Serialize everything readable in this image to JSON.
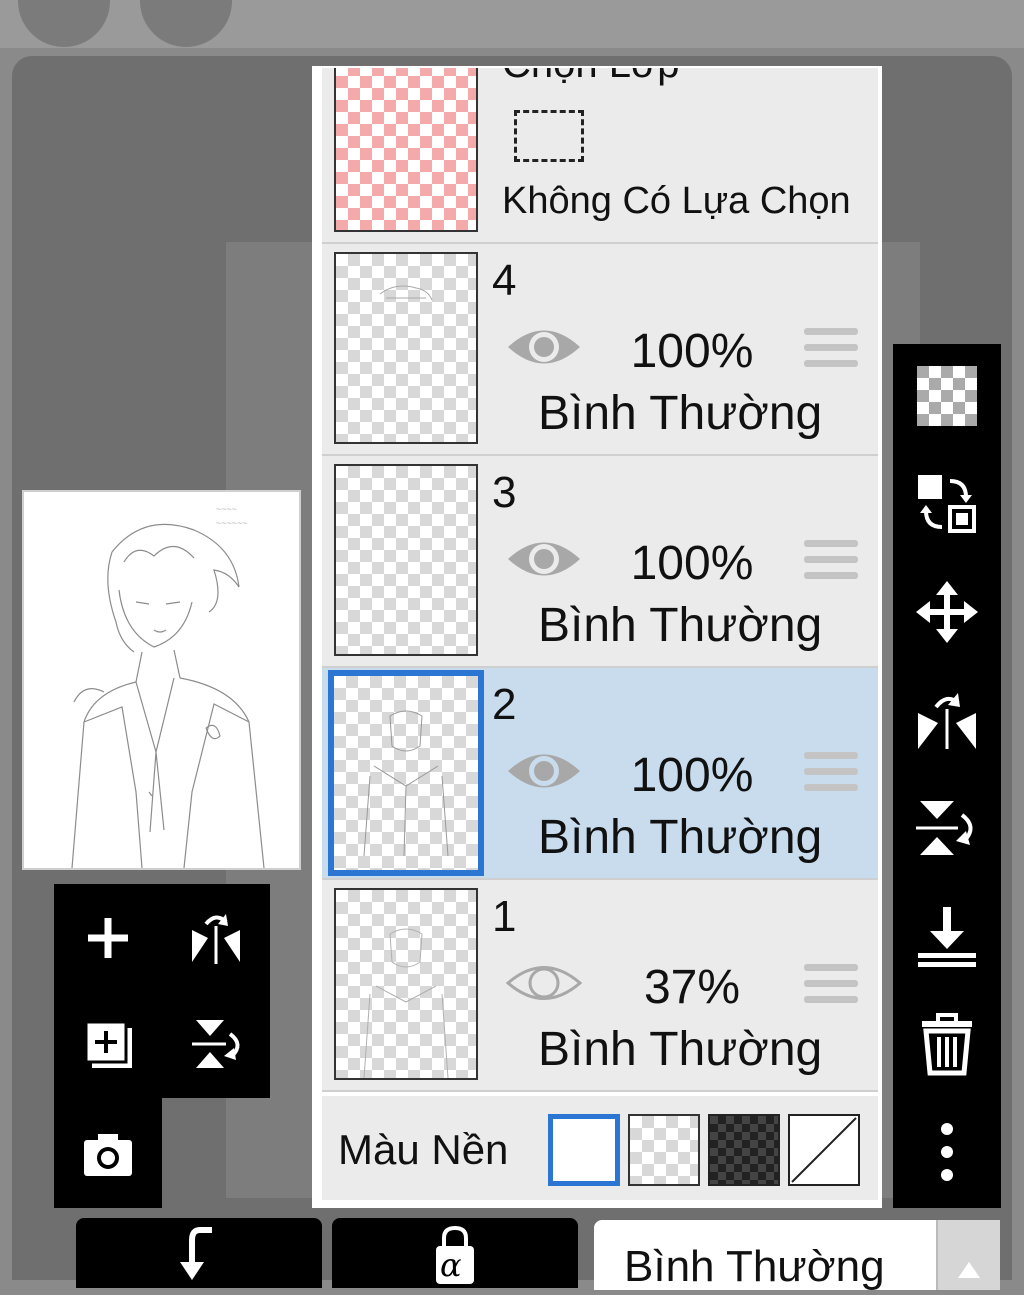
{
  "selection_layer": {
    "title": "Chọn Lớp",
    "status": "Không Có Lựa Chọn"
  },
  "layers": [
    {
      "number": "4",
      "opacity": "100%",
      "blend_mode": "Bình Thường",
      "visible": true,
      "selected": false
    },
    {
      "number": "3",
      "opacity": "100%",
      "blend_mode": "Bình Thường",
      "visible": true,
      "selected": false
    },
    {
      "number": "2",
      "opacity": "100%",
      "blend_mode": "Bình Thường",
      "visible": true,
      "selected": true
    },
    {
      "number": "1",
      "opacity": "37%",
      "blend_mode": "Bình Thường",
      "visible": true,
      "selected": false
    }
  ],
  "background": {
    "label": "Màu Nền",
    "options": [
      "white",
      "transparent",
      "dark-checker",
      "none"
    ],
    "selected": "white"
  },
  "bottom_bar": {
    "blend_mode": "Bình Thường",
    "alpha_lock_glyph": "α"
  },
  "colors": {
    "selected_layer_bg": "#c8dcee",
    "selected_outline": "#2a76d2",
    "selection_checker": "#f4aaaa"
  },
  "icons": {
    "left_tools": [
      "add-layer-icon",
      "flip-horizontal-icon",
      "add-copy-layer-icon",
      "flip-vertical-icon",
      "camera-icon"
    ],
    "right_tools": [
      "transparency-icon",
      "swap-layer-icon",
      "move-icon",
      "flip-horizontal-icon",
      "flip-vertical-icon",
      "merge-down-icon",
      "trash-icon",
      "more-icon"
    ]
  }
}
